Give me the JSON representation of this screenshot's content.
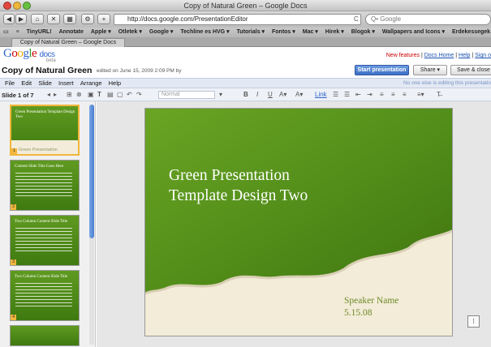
{
  "window": {
    "title": "Copy of Natural Green – Google Docs"
  },
  "nav": {
    "url": "http://docs.google.com/PresentationEditor",
    "search_placeholder": "Q• Google",
    "reload_glyph": "C"
  },
  "bookmarks": [
    "TinyURL!",
    "Annotate",
    "Apple ▾",
    "Otletek ▾",
    "Google ▾",
    "Techline es HVG ▾",
    "Tutorials ▾",
    "Fontos ▾",
    "Mac ▾",
    "Hirek ▾",
    "Blogok ▾",
    "Wallpapers and Icons ▾",
    "Erdekessegek ▾"
  ],
  "browser_tab": {
    "label": "Copy of Natural Green – Google Docs"
  },
  "gdocs": {
    "logo_google": "Google",
    "logo_docs": "docs",
    "beta": "beta",
    "new_features": "New features",
    "sep": " | ",
    "docs_home": "Docs Home",
    "help": "Help",
    "sign_out": "Sign o"
  },
  "doc": {
    "title": "Copy of Natural Green",
    "edited": "edited on June 15, 2009 2:09 PM by",
    "start_presentation": "Start presentation",
    "share": "Share ▾",
    "save_close": "Save & close"
  },
  "menu": {
    "items": [
      "File",
      "Edit",
      "Slide",
      "Insert",
      "Arrange",
      "Help"
    ],
    "editing_note": "No one else is editing this presentatio"
  },
  "toolbar": {
    "slide_count": "Slide 1 of 7",
    "font_value": "Normal"
  },
  "thumbs": [
    {
      "num": "1",
      "title": "Green Presentation Template Design Two",
      "sub": "Green Presentation",
      "selected": true
    },
    {
      "num": "2",
      "title": "Content Slide Title Goes Here",
      "sub": "",
      "selected": false
    },
    {
      "num": "3",
      "title": "Two Column Content Slide Title",
      "sub": "",
      "selected": false
    },
    {
      "num": "4",
      "title": "Two Column Content Slide Title",
      "sub": "",
      "selected": false
    }
  ],
  "slide": {
    "title": "Green Presentation\nTemplate Design Two",
    "speaker": "Speaker Name",
    "date": "5.15.08"
  },
  "colors": {
    "accent_blue": "#3c6fc4",
    "slide_green": "#5a921c",
    "paper": "#f3ecd8",
    "selection": "#f1b63b",
    "new_features_red": "#cc0000"
  }
}
